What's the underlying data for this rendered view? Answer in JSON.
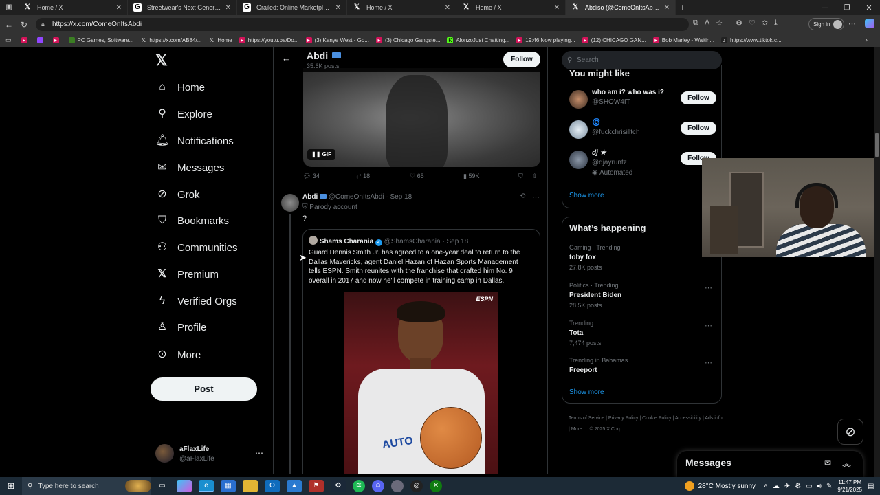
{
  "browser": {
    "tabs": [
      {
        "title": "Home / X",
        "icon": "x-logo-icon",
        "active": false
      },
      {
        "title": "Streetwear's Next Generation Col",
        "icon": "site-icon",
        "active": false
      },
      {
        "title": "Grailed: Online Marketplace to B",
        "icon": "site-icon",
        "active": false
      },
      {
        "title": "Home / X",
        "icon": "x-logo-icon",
        "active": false
      },
      {
        "title": "Home / X",
        "icon": "x-logo-icon",
        "active": false
      },
      {
        "title": "Abdiso (@ComeOnItsAbdi) / X",
        "icon": "x-logo-icon",
        "active": true
      }
    ],
    "url": "https://x.com/ComeOnItsAbdi",
    "sign_in": "Sign in",
    "bookmarks": [
      {
        "label": "",
        "color": "#d4145a"
      },
      {
        "label": "",
        "color": "#9146ff"
      },
      {
        "label": "",
        "color": "#d4145a"
      },
      {
        "label": "PC Games, Software...",
        "color": "#3b7d23"
      },
      {
        "label": "https://x.com/AB84/...",
        "color": "#333333"
      },
      {
        "label": "Home",
        "color": "#333333"
      },
      {
        "label": "https://youtu.be/Do...",
        "color": "#d4145a"
      },
      {
        "label": "(3) Kanye West - Go...",
        "color": "#d4145a"
      },
      {
        "label": "(3) Chicago Gangste...",
        "color": "#d4145a"
      },
      {
        "label": "AlonzoJust Chatting...",
        "color": "#53fc18"
      },
      {
        "label": "19:46 Now playing...",
        "color": "#d4145a"
      },
      {
        "label": "(12) CHICAGO GAN...",
        "color": "#d4145a"
      },
      {
        "label": "Bob Marley - Waitin...",
        "color": "#d4145a"
      },
      {
        "label": "https://www.tiktok.c...",
        "color": "#222222"
      }
    ]
  },
  "nav": {
    "items": [
      {
        "label": "Home",
        "icon": "home-icon"
      },
      {
        "label": "Explore",
        "icon": "search-icon"
      },
      {
        "label": "Notifications",
        "icon": "bell-icon"
      },
      {
        "label": "Messages",
        "icon": "mail-icon"
      },
      {
        "label": "Grok",
        "icon": "grok-icon"
      },
      {
        "label": "Bookmarks",
        "icon": "bookmark-icon"
      },
      {
        "label": "Communities",
        "icon": "people-icon"
      },
      {
        "label": "Premium",
        "icon": "x-logo-icon"
      },
      {
        "label": "Verified Orgs",
        "icon": "bolt-icon"
      },
      {
        "label": "Profile",
        "icon": "person-icon"
      },
      {
        "label": "More",
        "icon": "more-circle-icon"
      }
    ],
    "post_label": "Post",
    "account": {
      "name": "aFlaxLife",
      "handle": "@aFlaxLife"
    }
  },
  "profile_header": {
    "name": "Abdi",
    "posts": "35.6K posts",
    "follow_label": "Follow"
  },
  "gif_post": {
    "gif_badge": "GIF",
    "stats": {
      "replies": "34",
      "reposts": "18",
      "likes": "65",
      "views": "59K"
    }
  },
  "post": {
    "author": "Abdi",
    "handle": "@ComeOnItsAbdi",
    "date": "Sep 18",
    "label": "Parody account",
    "text": "?",
    "quote": {
      "author": "Shams Charania",
      "handle": "@ShamsCharania",
      "date": "Sep 18",
      "text": "Guard Dennis Smith Jr. has agreed to a one-year deal to return to the Dallas Mavericks, agent Daniel Hazan of Hazan Sports Management tells ESPN. Smith reunites with the franchise that drafted him No. 9 overall in 2017 and now he'll compete in training camp in Dallas.",
      "image_watermark": "ESPN",
      "jersey_text": "AUTO"
    }
  },
  "sidebar": {
    "search_placeholder": "Search",
    "you_might_like": {
      "title": "You might like",
      "users": [
        {
          "name": "who am i? who was i?",
          "handle": "@SHOW4IT",
          "follow": "Follow",
          "badge": ""
        },
        {
          "name": "🌀",
          "handle": "@fuckchrisilltch",
          "follow": "Follow",
          "badge": ""
        },
        {
          "name": "dj ★",
          "handle": "@djayruntz",
          "follow": "Follow",
          "badge": "Automated"
        }
      ],
      "show_more": "Show more"
    },
    "happening": {
      "title": "What’s happening",
      "trends": [
        {
          "context": "Gaming · Trending",
          "topic": "toby fox",
          "count": "27.8K posts"
        },
        {
          "context": "Politics · Trending",
          "topic": "President Biden",
          "count": "28.5K posts"
        },
        {
          "context": "Trending",
          "topic": "Tota",
          "count": "7,474 posts"
        },
        {
          "context": "Trending in Bahamas",
          "topic": "Freeport",
          "count": ""
        }
      ],
      "show_more": "Show more"
    },
    "footer_links": [
      "Terms of Service",
      "Privacy Policy",
      "Cookie Policy",
      "Accessibility",
      "Ads info",
      "More …",
      "© 2025 X Corp."
    ]
  },
  "messages_drawer": {
    "title": "Messages"
  },
  "taskbar": {
    "search_placeholder": "Type here to search",
    "weather": "28°C  Mostly sunny",
    "time": "11:47 PM",
    "date": "9/21/2025"
  }
}
